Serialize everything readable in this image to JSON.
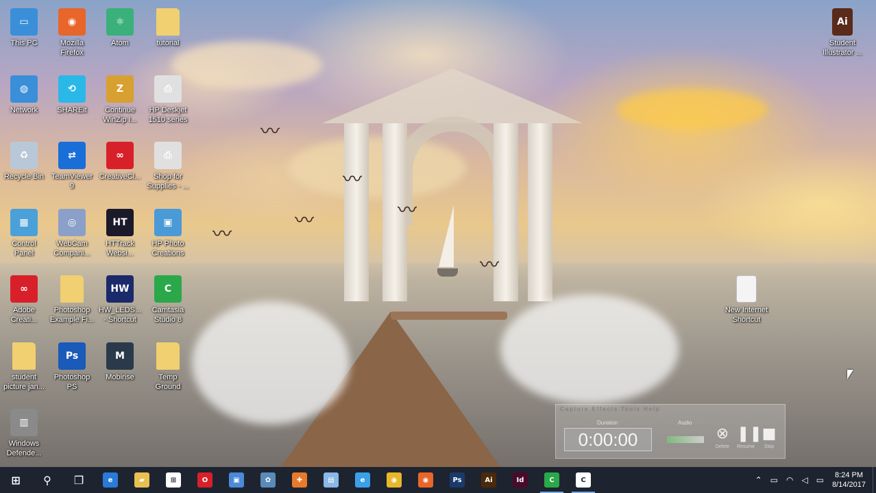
{
  "desktop_icons": [
    {
      "label": "This PC",
      "icon": "this-pc-icon",
      "color": "#3a8fd8"
    },
    {
      "label": "Mozilla\nFirefox",
      "icon": "firefox-icon",
      "color": "#e8662a"
    },
    {
      "label": "Atom",
      "icon": "atom-icon",
      "color": "#3ab07a"
    },
    {
      "label": "tutorial",
      "icon": "folder-icon",
      "color": "#f0d070"
    },
    {
      "label": "Network",
      "icon": "network-icon",
      "color": "#3a8fd8"
    },
    {
      "label": "SHAREit",
      "icon": "shareit-icon",
      "color": "#2ab8e8"
    },
    {
      "label": "Continue\nWinZip I...",
      "icon": "winzip-icon",
      "color": "#d8a030"
    },
    {
      "label": "HP Deskjet\n1510 series",
      "icon": "printer-icon",
      "color": "#e0e0e0"
    },
    {
      "label": "Recycle Bin",
      "icon": "recycle-bin-icon",
      "color": "#b8c8d8"
    },
    {
      "label": "TeamViewer\n9",
      "icon": "teamviewer-icon",
      "color": "#1a6ed8"
    },
    {
      "label": "CreativeCl...",
      "icon": "creative-cloud-icon",
      "color": "#d8202a"
    },
    {
      "label": "Shop for\nSupplies - ...",
      "icon": "printer-supplies-icon",
      "color": "#e0e0e0"
    },
    {
      "label": "Control\nPanel",
      "icon": "control-panel-icon",
      "color": "#4aa0d8"
    },
    {
      "label": "WebCam\nCompani...",
      "icon": "webcam-icon",
      "color": "#8aa0c8"
    },
    {
      "label": "HTTrack\nWebsi...",
      "icon": "httrack-icon",
      "color": "#1a1a2a"
    },
    {
      "label": "HP Photo\nCreations",
      "icon": "hp-photo-icon",
      "color": "#4a9ad8"
    },
    {
      "label": "Adobe\nCreati...",
      "icon": "adobe-cc-icon",
      "color": "#d8202a"
    },
    {
      "label": "Photoshop\nExample Fi...",
      "icon": "folder-icon",
      "color": "#f0d070"
    },
    {
      "label": "HW_LEDS...\n- Shortcut",
      "icon": "hw-leds-icon",
      "color": "#1a2a6a"
    },
    {
      "label": "Camtasia\nStudio 8",
      "icon": "camtasia-icon",
      "color": "#2aa84a"
    },
    {
      "label": "student\npicture jan...",
      "icon": "folder-icon",
      "color": "#f0d070"
    },
    {
      "label": "Photoshop\nPS",
      "icon": "photoshop-icon",
      "color": "#1a5ab8"
    },
    {
      "label": "Mobirise",
      "icon": "mobirise-icon",
      "color": "#2a3a4a"
    },
    {
      "label": "Temp\nGround",
      "icon": "folder-icon",
      "color": "#f0d070"
    },
    {
      "label": "Windows\nDefende...",
      "icon": "windows-defender-icon",
      "color": "#8a8a8a"
    }
  ],
  "right_icons": [
    {
      "label": "Student\nIllustrator ...",
      "icon": "illustrator-book-icon",
      "color": "#5a2a1a"
    },
    {
      "label": "New Internet\nShortcut",
      "icon": "internet-shortcut-icon",
      "color": "#f4f4f4"
    }
  ],
  "icon_glyphs": {
    "this-pc-icon": "▭",
    "firefox-icon": "◉",
    "atom-icon": "⚛",
    "folder-icon": "",
    "network-icon": "◍",
    "shareit-icon": "⟲",
    "winzip-icon": "Z",
    "printer-icon": "⎙",
    "recycle-bin-icon": "♻",
    "teamviewer-icon": "⇄",
    "creative-cloud-icon": "∞",
    "printer-supplies-icon": "⎙",
    "control-panel-icon": "▦",
    "webcam-icon": "◎",
    "httrack-icon": "HT",
    "hp-photo-icon": "▣",
    "adobe-cc-icon": "∞",
    "hw-leds-icon": "HW",
    "camtasia-icon": "C",
    "photoshop-icon": "Ps",
    "mobirise-icon": "M",
    "windows-defender-icon": "▥",
    "illustrator-book-icon": "Ai",
    "internet-shortcut-icon": ""
  },
  "recorder": {
    "menu": "Capture  Effects  Tools  Help",
    "duration_label": "Duration",
    "time": "0:00:00",
    "audio_label": "Audio",
    "delete_label": "Delete",
    "resume_label": "Resume",
    "stop_label": "Stop"
  },
  "taskbar": {
    "buttons": [
      {
        "name": "start-button",
        "glyph": "⊞",
        "color": "",
        "active": false
      },
      {
        "name": "search-button",
        "glyph": "⚲",
        "color": "",
        "active": false
      },
      {
        "name": "task-view-button",
        "glyph": "❐",
        "color": "",
        "active": false
      },
      {
        "name": "edge-button",
        "glyph": "e",
        "color": "#2a7ad8",
        "active": false
      },
      {
        "name": "file-explorer-button",
        "glyph": "▰",
        "color": "#e8c050",
        "active": false
      },
      {
        "name": "store-button",
        "glyph": "⊞",
        "color": "#ffffff",
        "active": false
      },
      {
        "name": "opera-button",
        "glyph": "O",
        "color": "#d8202a",
        "active": false
      },
      {
        "name": "app-button-1",
        "glyph": "▣",
        "color": "#4a8ad8",
        "active": false
      },
      {
        "name": "app-button-2",
        "glyph": "✿",
        "color": "#5a8ab8",
        "active": false
      },
      {
        "name": "app-button-3",
        "glyph": "✚",
        "color": "#e87a2a",
        "active": false
      },
      {
        "name": "notepad-button",
        "glyph": "▤",
        "color": "#8ab8e8",
        "active": false
      },
      {
        "name": "internet-explorer-button",
        "glyph": "e",
        "color": "#3aa0e8",
        "active": false
      },
      {
        "name": "chrome-button",
        "glyph": "◉",
        "color": "#e8b82a",
        "active": false
      },
      {
        "name": "firefox-button",
        "glyph": "◉",
        "color": "#e8662a",
        "active": false
      },
      {
        "name": "photoshop-button",
        "glyph": "Ps",
        "color": "#1a3a6a",
        "active": false
      },
      {
        "name": "illustrator-button",
        "glyph": "Ai",
        "color": "#4a2a0a",
        "active": false
      },
      {
        "name": "indesign-button",
        "glyph": "Id",
        "color": "#4a0a2a",
        "active": false
      },
      {
        "name": "camtasia-button",
        "glyph": "C",
        "color": "#2aa84a",
        "active": true
      },
      {
        "name": "camtasia-recorder-button",
        "glyph": "C",
        "color": "#ffffff",
        "active": true
      }
    ],
    "tray": {
      "chevron": "⌃",
      "battery": "▭",
      "wifi": "◠",
      "volume": "◁",
      "notifications": "▭",
      "time": "8:24 PM",
      "date": "8/14/2017"
    }
  }
}
